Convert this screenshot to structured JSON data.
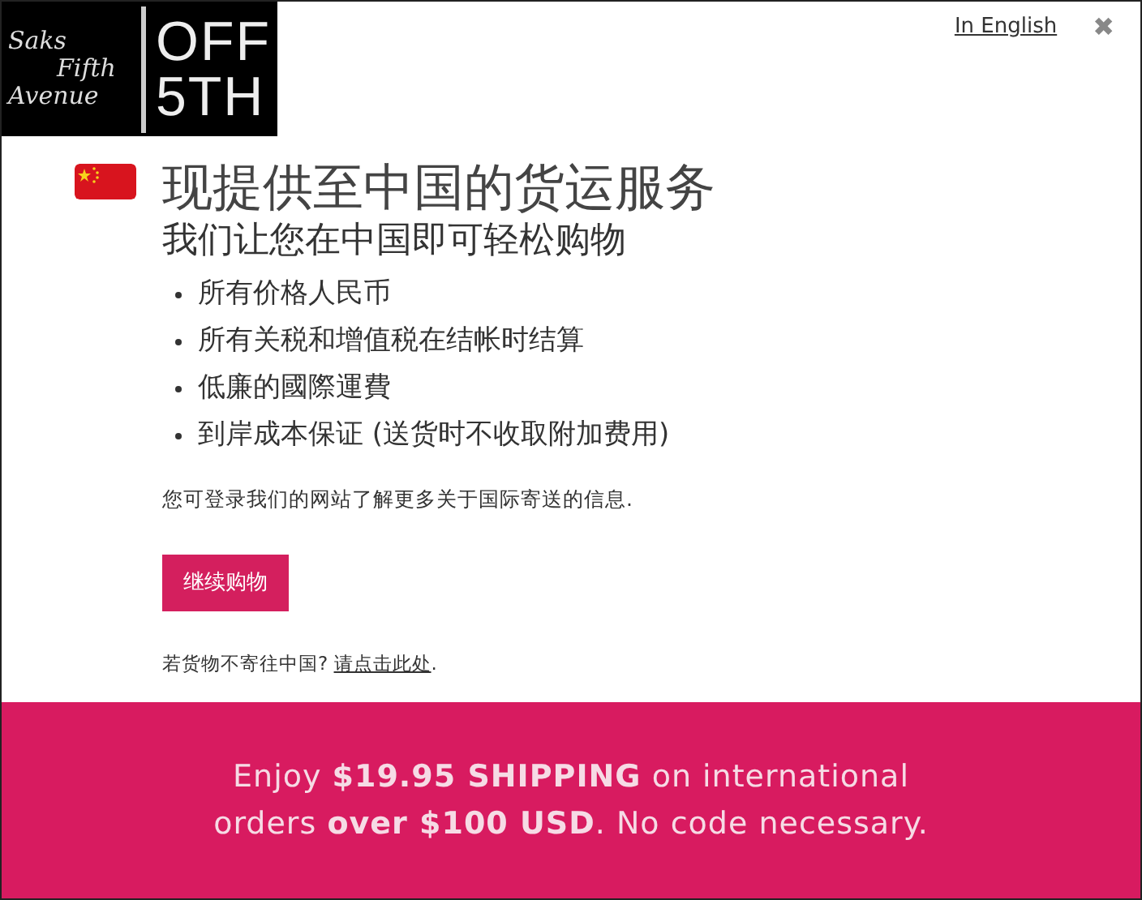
{
  "logo": {
    "left": [
      "Saks",
      "Fifth",
      "Avenue"
    ],
    "right": [
      "OFF",
      "5TH"
    ]
  },
  "language_link": "In English",
  "close": "✖",
  "title": "现提供至中国的货运服务",
  "subtitle": "我们让您在中国即可轻松购物",
  "features": [
    "所有价格人民币",
    "所有关税和增值税在结帐时结算",
    "低廉的國際運費",
    "到岸成本保证 (送货时不收取附加费用)"
  ],
  "info": "您可登录我们的网站了解更多关于国际寄送的信息.",
  "continue_button": "继续购物",
  "footer": {
    "text": "若货物不寄往中国? ",
    "link": "请点击此处",
    "end": "."
  },
  "banner": {
    "lines": [
      "Enjoy **$19.95 SHIPPING** on international",
      "orders **over $100 USD**. No code necessary."
    ]
  }
}
